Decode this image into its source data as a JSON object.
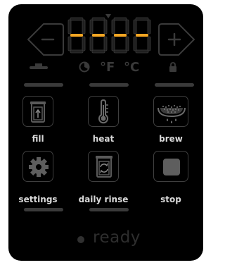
{
  "display": {
    "digits": [
      "-",
      "-",
      "-",
      "-"
    ],
    "segment_active_color": "#f5a623",
    "segment_inactive_color": "#1f1f1f"
  },
  "controls": {
    "decrease_icon": "minus-icon",
    "increase_icon": "plus-icon"
  },
  "indicators": {
    "fahrenheit": "°F",
    "celsius": "°C",
    "icons": [
      "level-icon",
      "timer-icon",
      "lock-icon"
    ]
  },
  "buttons": [
    {
      "label": "fill",
      "icon": "fill-icon"
    },
    {
      "label": "heat",
      "icon": "thermometer-icon"
    },
    {
      "label": "brew",
      "icon": "brew-icon"
    },
    {
      "label": "settings",
      "icon": "gear-icon"
    },
    {
      "label": "daily rinse",
      "icon": "rinse-icon"
    },
    {
      "label": "stop",
      "icon": "stop-icon"
    }
  ],
  "status": {
    "text": "ready"
  },
  "colors": {
    "panel_background": "#000000",
    "label_text": "#d9d9d9",
    "dim": "#3a3a3a"
  }
}
